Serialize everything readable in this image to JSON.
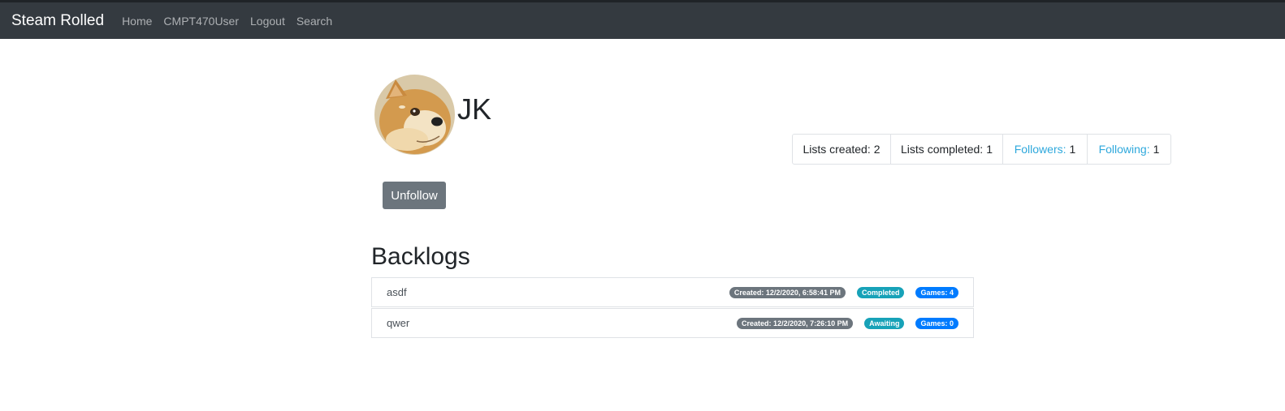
{
  "navbar": {
    "brand": "Steam Rolled",
    "links": [
      "Home",
      "CMPT470User",
      "Logout",
      "Search"
    ]
  },
  "profile": {
    "name": "JK"
  },
  "stats": {
    "lists_created_label": "Lists created:",
    "lists_created_value": "2",
    "lists_completed_label": "Lists completed:",
    "lists_completed_value": "1",
    "followers_label": "Followers:",
    "followers_value": "1",
    "following_label": "Following:",
    "following_value": "1"
  },
  "actions": {
    "unfollow_label": "Unfollow"
  },
  "backlogs": {
    "title": "Backlogs",
    "items": [
      {
        "name": "asdf",
        "created": "Created: 12/2/2020, 6:58:41 PM",
        "status": "Completed",
        "games": "Games: 4"
      },
      {
        "name": "qwer",
        "created": "Created: 12/2/2020, 7:26:10 PM",
        "status": "Awaiting",
        "games": "Games: 0"
      }
    ]
  },
  "colors": {
    "navbar_bg": "#343a40",
    "link_blue": "#2ea8dc",
    "badge_secondary": "#6c757d",
    "badge_info": "#17a2b8",
    "badge_primary": "#007bff",
    "button_secondary": "#6c757d"
  }
}
